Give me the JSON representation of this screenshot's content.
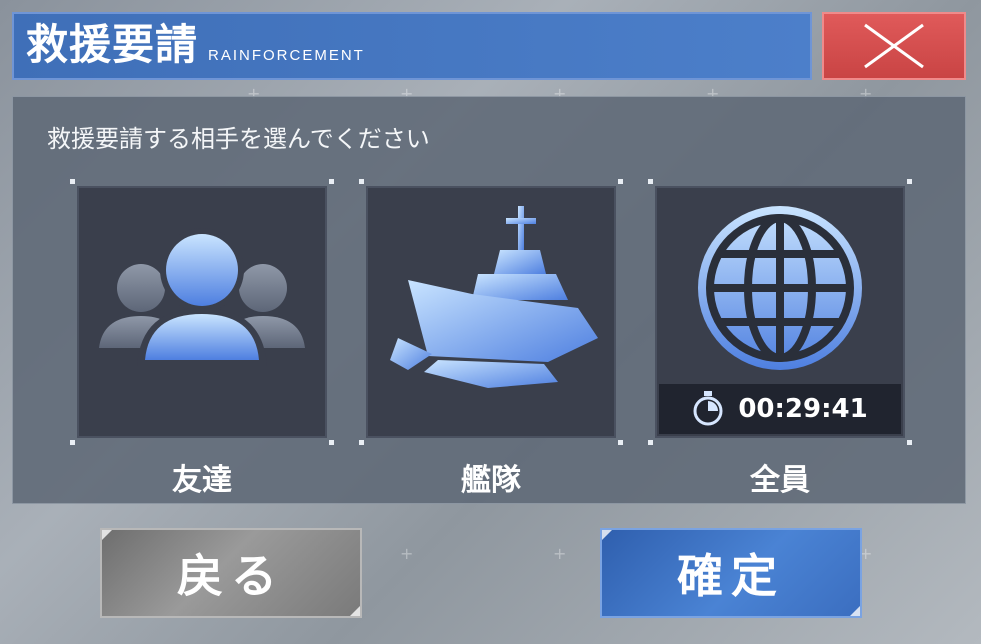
{
  "header": {
    "title": "救援要請",
    "subtitle": "RAINFORCEMENT"
  },
  "dialog": {
    "prompt": "救援要請する相手を選んでください",
    "options": [
      {
        "label": "友達",
        "icon": "friends-icon"
      },
      {
        "label": "艦隊",
        "icon": "battleship-icon"
      },
      {
        "label": "全員",
        "icon": "globe-icon",
        "timer": "00:29:41"
      }
    ]
  },
  "buttons": {
    "back": "戻る",
    "confirm": "確定"
  },
  "colors": {
    "title_bar": "#4c7fca",
    "close_button": "#d94f4f",
    "confirm_button": "#3b6ec0",
    "back_button": "#8a8a8a"
  }
}
